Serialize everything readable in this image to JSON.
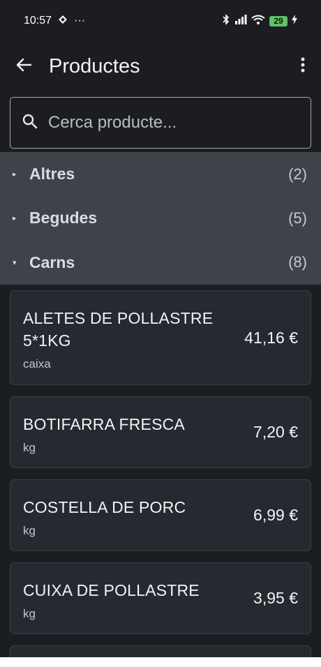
{
  "status_bar": {
    "time": "10:57",
    "dots": "···",
    "battery": "29"
  },
  "app_bar": {
    "title": "Productes",
    "back_icon": "arrow-left-icon",
    "menu_icon": "more-vert-icon"
  },
  "search": {
    "placeholder": "Cerca producte..."
  },
  "categories": [
    {
      "name": "Altres",
      "count": "(2)",
      "expanded": false
    },
    {
      "name": "Begudes",
      "count": "(5)",
      "expanded": false
    },
    {
      "name": "Carns",
      "count": "(8)",
      "expanded": true
    }
  ],
  "products": [
    {
      "name": "ALETES DE POLLASTRE 5*1KG",
      "unit": "caixa",
      "price": "41,16 €"
    },
    {
      "name": "BOTIFARRA FRESCA",
      "unit": "kg",
      "price": "7,20 €"
    },
    {
      "name": "COSTELLA DE PORC",
      "unit": "kg",
      "price": "6,99 €"
    },
    {
      "name": "CUIXA DE POLLASTRE",
      "unit": "kg",
      "price": "3,95 €"
    }
  ]
}
